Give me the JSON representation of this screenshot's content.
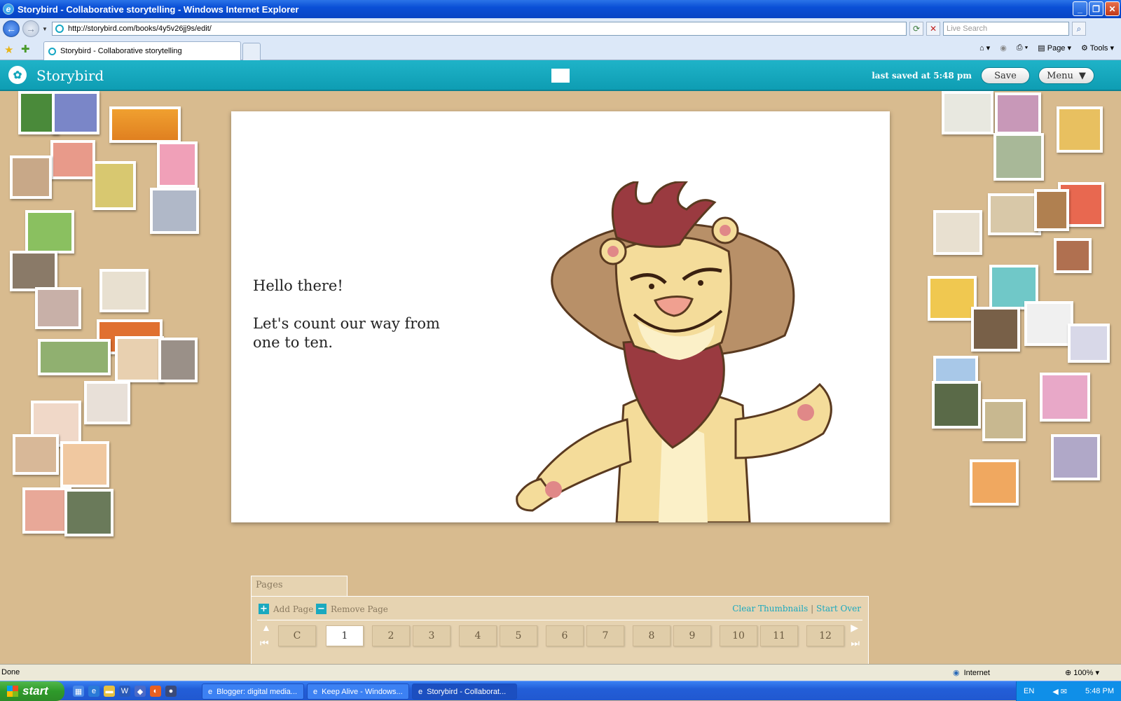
{
  "window": {
    "title": "Storybird - Collaborative storytelling - Windows Internet Explorer"
  },
  "browser": {
    "url": "http://storybird.com/books/4y5v26jj9s/edit/",
    "search_placeholder": "Live Search",
    "tab_title": "Storybird - Collaborative storytelling",
    "command_page": "Page",
    "command_tools": "Tools"
  },
  "app": {
    "name": "Storybird",
    "last_saved": "last saved at 5:48 pm",
    "save_label": "Save",
    "menu_label": "Menu"
  },
  "page_content": {
    "line1": "Hello there!",
    "line2": "Let's count our way from one to ten."
  },
  "pages_panel": {
    "tab_label": "Pages",
    "add_page": "Add Page",
    "remove_page": "Remove Page",
    "clear_thumbnails": "Clear Thumbnails",
    "start_over": "Start Over",
    "separator": "|",
    "pages": [
      "C",
      "1",
      "2",
      "3",
      "4",
      "5",
      "6",
      "7",
      "8",
      "9",
      "10",
      "11",
      "12"
    ],
    "active_page": "1"
  },
  "statusbar": {
    "status": "Done",
    "zone": "Internet",
    "zoom": "100%"
  },
  "taskbar": {
    "start_label": "start",
    "tasks": [
      "Blogger: digital media...",
      "Keep Alive - Windows...",
      "Storybird - Collaborat..."
    ],
    "language": "EN",
    "clock": "5:48 PM"
  },
  "colors": {
    "accent": "#1aa9bf",
    "board": "#d8bb8f"
  }
}
